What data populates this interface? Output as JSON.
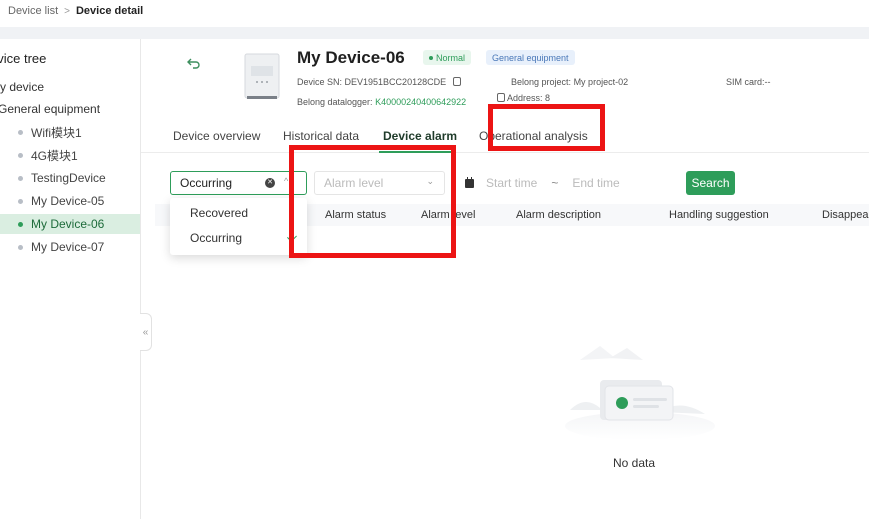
{
  "breadcrumb": {
    "parent": "Device list",
    "separator": ">",
    "current": "Device detail"
  },
  "sidebar": {
    "title": "evice tree",
    "group_root": "y device",
    "group_sub": "General equipment",
    "items": [
      {
        "label": "Wifi模块1",
        "active": false
      },
      {
        "label": "4G模块1",
        "active": false
      },
      {
        "label": "TestingDevice",
        "active": false
      },
      {
        "label": "My Device-05",
        "active": false
      },
      {
        "label": "My Device-06",
        "active": true
      },
      {
        "label": "My Device-07",
        "active": false
      }
    ],
    "collapse_glyph": "«"
  },
  "device": {
    "name": "My Device-06",
    "status": "Normal",
    "type": "General equipment",
    "sn_label": "Device SN:",
    "sn": "DEV1951BCC20128CDE",
    "project_label": "Belong project:",
    "project": "My project-02",
    "sim_label": "SIM card:",
    "sim": "--",
    "datalogger_label": "Belong datalogger:",
    "datalogger": "K40000240400642922",
    "address_label": "Address:",
    "address": "8"
  },
  "tabs": [
    {
      "label": "Device overview",
      "active": false
    },
    {
      "label": "Historical data",
      "active": false
    },
    {
      "label": "Device alarm",
      "active": true
    },
    {
      "label": "Operational analysis",
      "active": false
    }
  ],
  "filters": {
    "status_value": "Occurring",
    "level_placeholder": "Alarm level",
    "start_placeholder": "Start time",
    "range_separator": "~",
    "end_placeholder": "End time",
    "search_label": "Search"
  },
  "status_options": [
    {
      "label": "Recovered",
      "selected": false
    },
    {
      "label": "Occurring",
      "selected": true
    }
  ],
  "table": {
    "columns": [
      "Alarm status",
      "Alarm level",
      "Alarm description",
      "Handling suggestion",
      "Disappear"
    ]
  },
  "empty_text": "No data",
  "colors": {
    "accent": "#2e9d5a",
    "highlight": "#ec1414",
    "active_bg": "#daeee1"
  }
}
